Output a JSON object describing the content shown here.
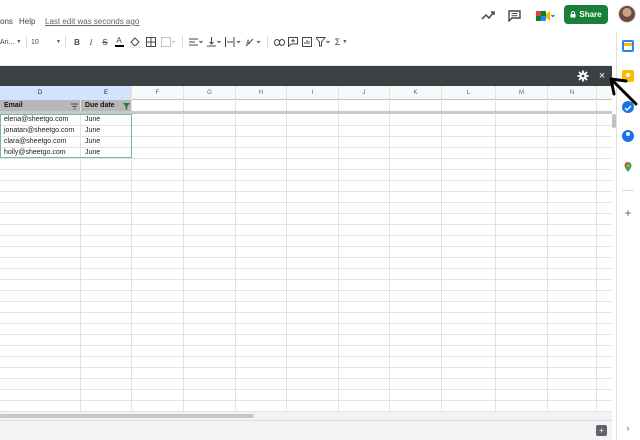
{
  "menubar": {
    "menu_items": [
      "ons",
      "Help"
    ],
    "last_edit": "Last edit was seconds ago",
    "share_label": "Share"
  },
  "toolbar": {
    "font_name": "Ari...",
    "font_size": "10",
    "icons": [
      "bold-icon",
      "italic-icon",
      "strikethrough-icon",
      "text-color-icon",
      "fill-color-icon",
      "borders-icon",
      "merge-cells-icon",
      "horizontal-align-icon",
      "vertical-align-icon",
      "text-wrap-icon",
      "text-rotate-icon",
      "link-icon",
      "comment-icon",
      "insert-chart-icon",
      "filter-icon",
      "functions-icon"
    ]
  },
  "grid": {
    "columns": [
      "D",
      "E",
      "F",
      "G",
      "H",
      "I",
      "J",
      "K",
      "L",
      "M",
      "N"
    ],
    "selected_columns": [
      "D",
      "E"
    ],
    "table": {
      "headers": [
        "Email",
        "Due date"
      ],
      "rows": [
        [
          "elena@sheetgo.com",
          "June"
        ],
        [
          "jonatan@sheetgo.com",
          "June"
        ],
        [
          "clara@sheetgo.com",
          "June"
        ],
        [
          "holly@sheetgo.com",
          "June"
        ]
      ]
    }
  },
  "addon_bar": {
    "close_glyph": "×"
  },
  "colors": {
    "share_green": "#188038",
    "addon_bar": "#3c4043",
    "header_fill": "#b7b7b7",
    "table_border": "#7fb797",
    "selected_col": "#d3e3fd"
  }
}
